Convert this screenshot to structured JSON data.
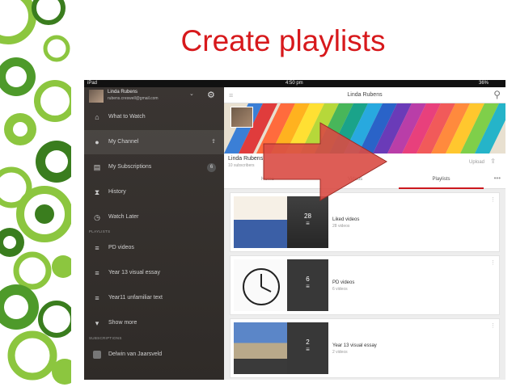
{
  "slide": {
    "title": "Create playlists",
    "colors": {
      "title": "#d7191c",
      "deco_green": "#8cc63f",
      "deco_dark": "#3a7d1e",
      "arrow": "#d94b44"
    }
  },
  "status_bar": {
    "carrier": "iPad",
    "time": "4:50 pm",
    "battery": "36%"
  },
  "sidebar": {
    "account": {
      "name": "Linda Rubens",
      "email": "rubens.creswell@gmail.com"
    },
    "nav": [
      {
        "label": "What to Watch",
        "icon": "home-icon"
      },
      {
        "label": "My Channel",
        "icon": "user-icon",
        "active": true
      },
      {
        "label": "My Subscriptions",
        "icon": "subscriptions-icon",
        "count": "6"
      },
      {
        "label": "History",
        "icon": "hourglass-icon"
      },
      {
        "label": "Watch Later",
        "icon": "clock-icon"
      }
    ],
    "playlists_header": "PLAYLISTS",
    "playlists": [
      {
        "label": "PD videos"
      },
      {
        "label": "Year 13 visual essay"
      },
      {
        "label": "Year11 unfamiliar text"
      }
    ],
    "show_more": "Show more",
    "subscriptions_header": "SUBSCRIPTIONS",
    "subscriptions": [
      {
        "label": "Delwin van Jaarsveld"
      }
    ]
  },
  "main": {
    "title": "Linda Rubens",
    "channel": {
      "name": "Linda Rubens",
      "subs": "10 subscribers",
      "upload": "Upload"
    },
    "tabs": [
      {
        "label": "Home"
      },
      {
        "label": "Videos"
      },
      {
        "label": "Playlists",
        "active": true
      }
    ],
    "playlists": [
      {
        "title": "Liked videos",
        "sub": "28 videos",
        "count": "28"
      },
      {
        "title": "PD videos",
        "sub": "6 videos",
        "count": "6"
      },
      {
        "title": "Year 13 visual essay",
        "sub": "2 videos",
        "count": "2"
      }
    ]
  }
}
